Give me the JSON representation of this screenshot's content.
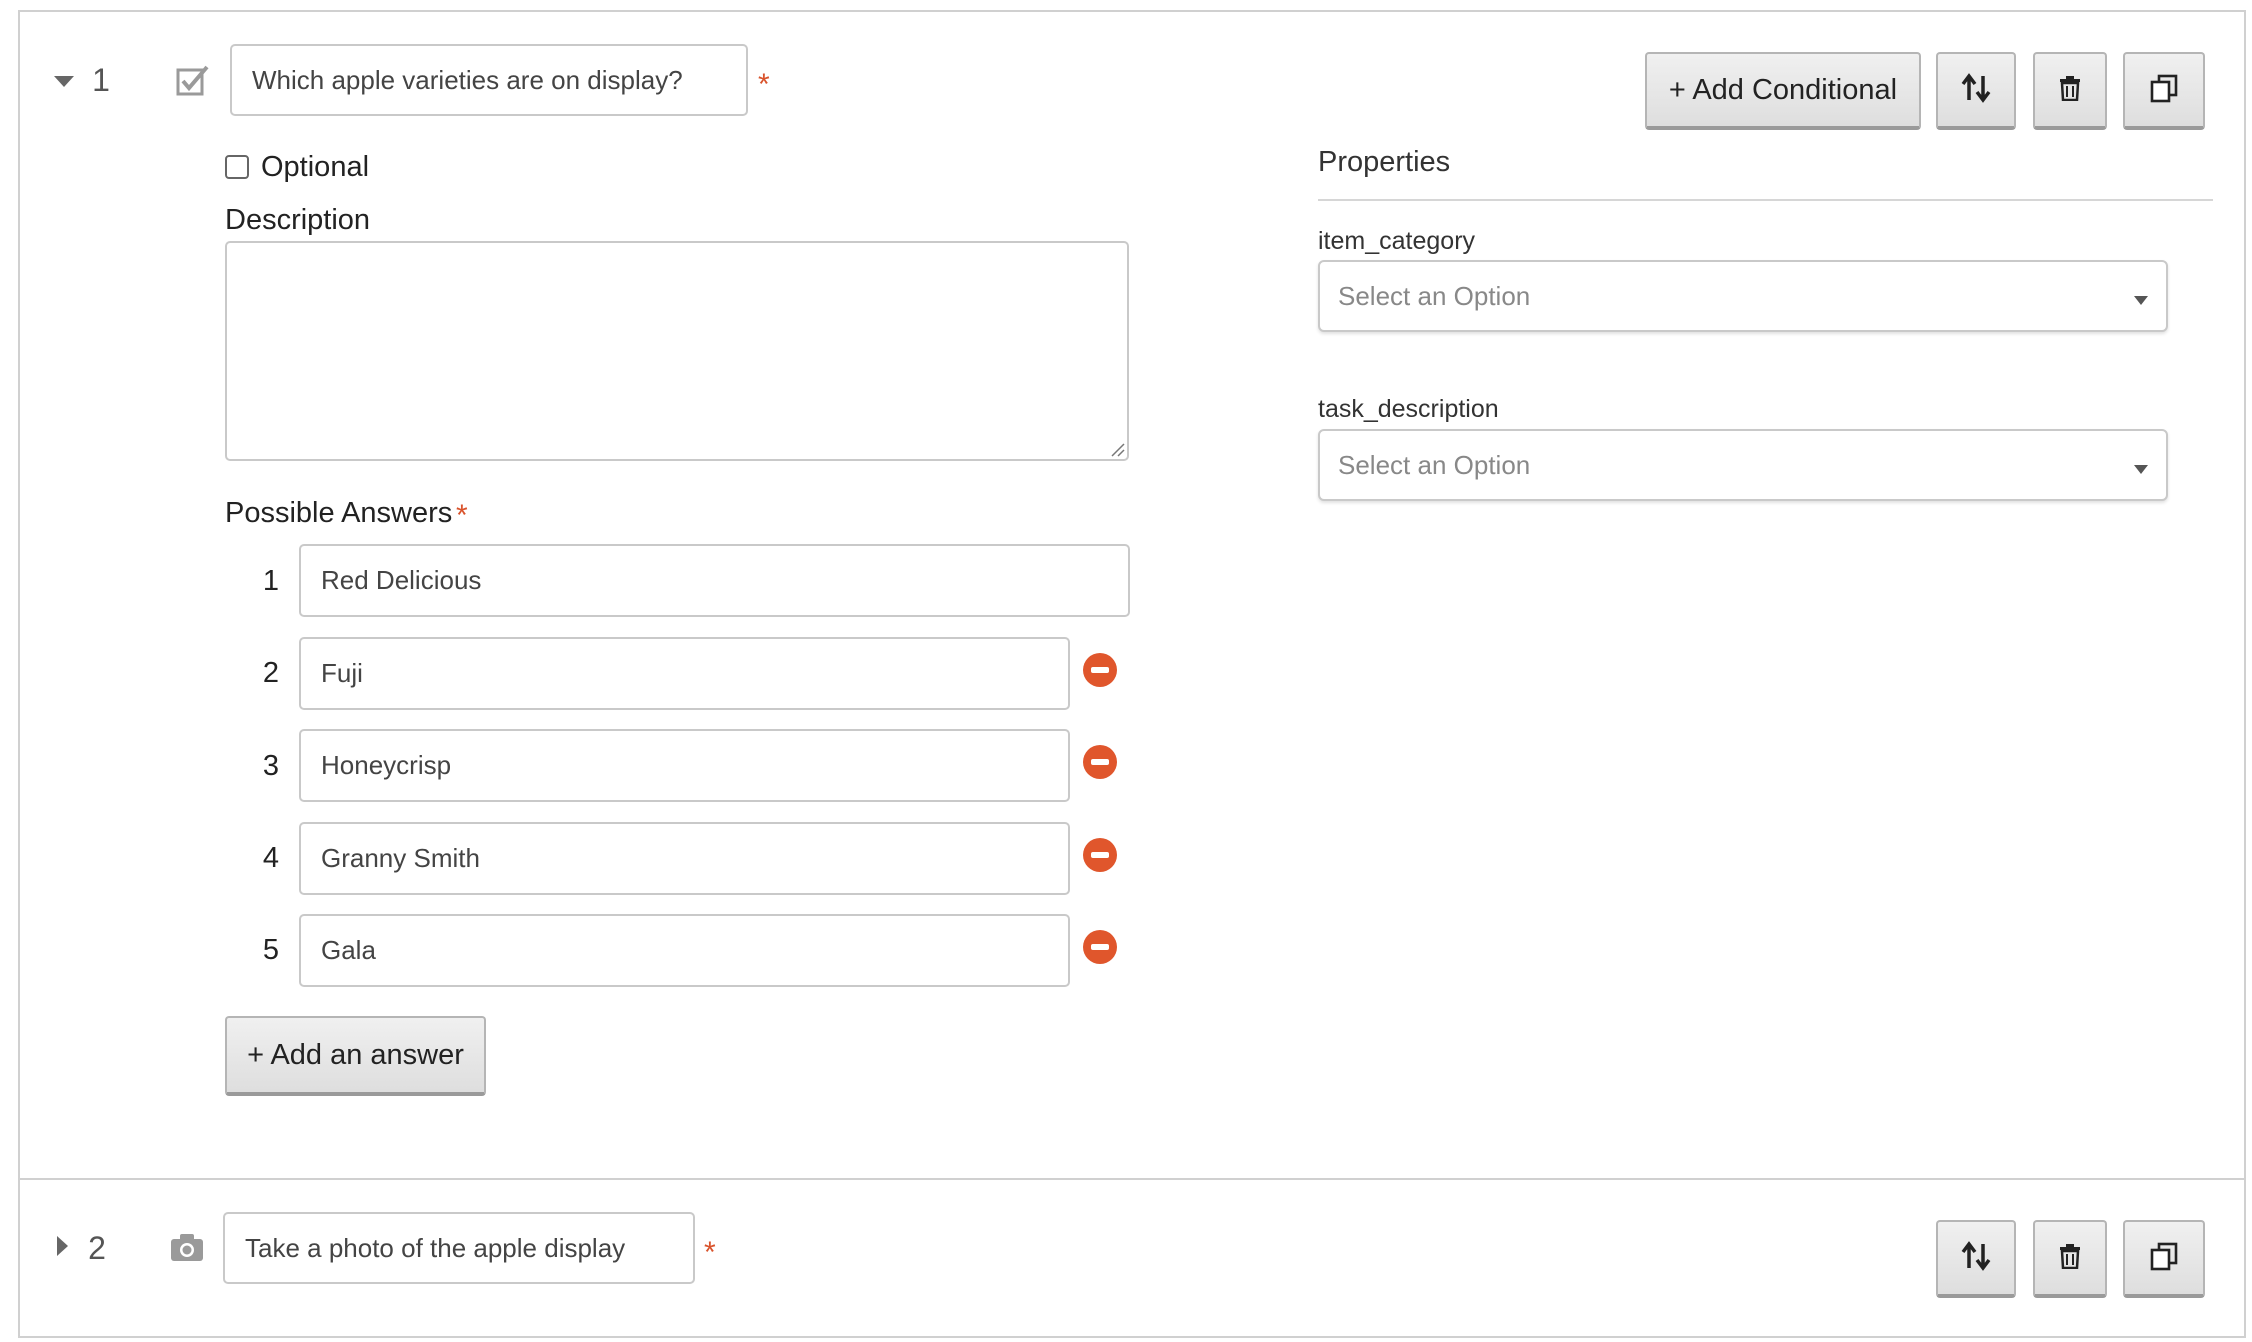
{
  "questions": [
    {
      "number": "1",
      "prompt": "Which apple varieties are on display?",
      "required_mark": "*",
      "optional_label": "Optional",
      "description_label": "Description",
      "description_value": "",
      "answers_label": "Possible Answers",
      "answers_required_mark": "*",
      "answers": [
        {
          "number": "1",
          "value": "Red Delicious"
        },
        {
          "number": "2",
          "value": "Fuji"
        },
        {
          "number": "3",
          "value": "Honeycrisp"
        },
        {
          "number": "4",
          "value": "Granny Smith"
        },
        {
          "number": "5",
          "value": "Gala"
        }
      ],
      "add_answer_label": "+ Add an answer",
      "add_conditional_label": "+ Add Conditional",
      "properties": {
        "title": "Properties",
        "fields": [
          {
            "label": "item_category",
            "placeholder": "Select an Option"
          },
          {
            "label": "task_description",
            "placeholder": "Select an Option"
          }
        ]
      }
    },
    {
      "number": "2",
      "prompt": "Take a photo of the apple display",
      "required_mark": "*"
    }
  ],
  "icons": {
    "q1_type": "checkbox-icon",
    "q2_type": "camera-icon",
    "reorder": "sort-arrows-icon",
    "delete": "trash-icon",
    "duplicate": "copy-icon",
    "remove": "remove-circle-icon"
  },
  "colors": {
    "required": "#d9532c",
    "remove": "#e0562c"
  }
}
